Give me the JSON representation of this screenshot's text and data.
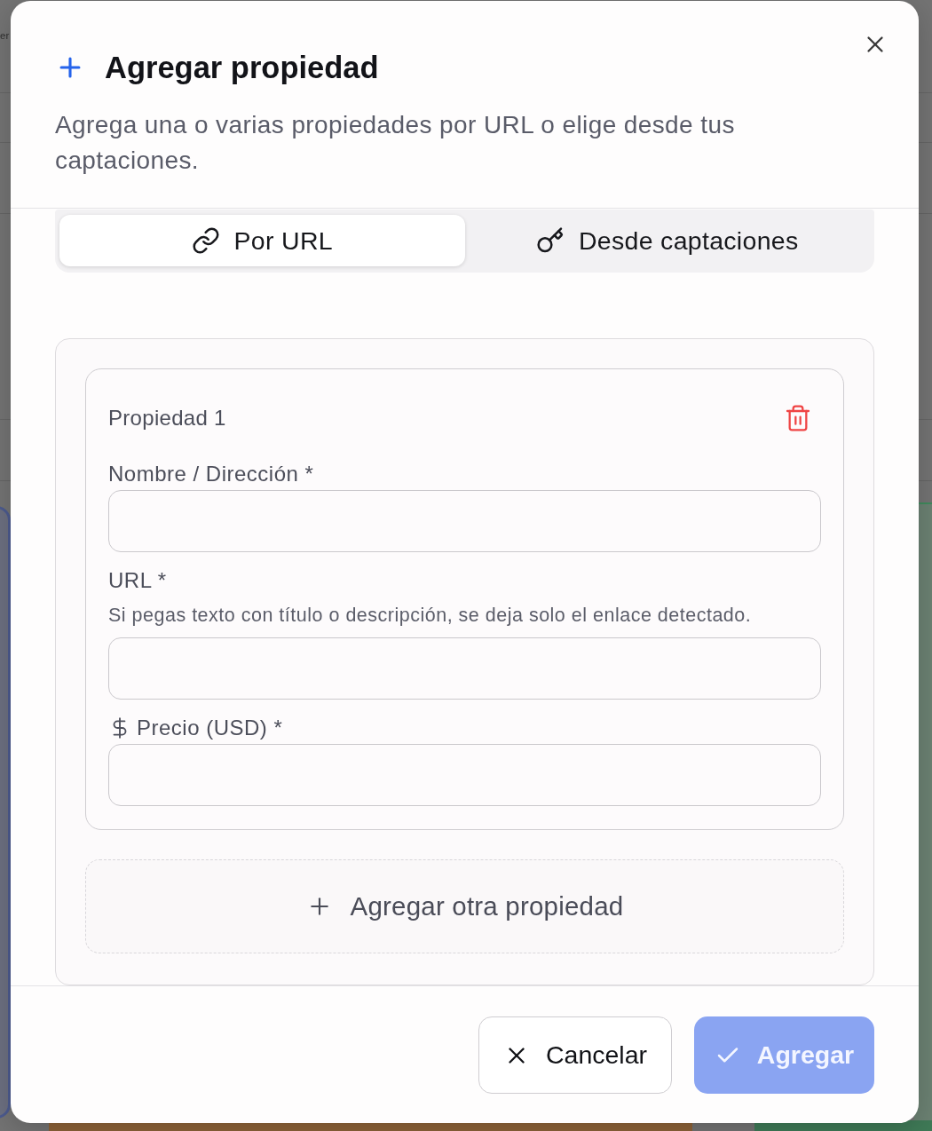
{
  "background": {
    "text": "er"
  },
  "dialog": {
    "title": "Agregar propiedad",
    "description": "Agrega una o varias propiedades por URL o elige desde tus captaciones."
  },
  "tabs": [
    {
      "label": "Por URL",
      "selected": true
    },
    {
      "label": "Desde captaciones",
      "selected": false
    }
  ],
  "properties": [
    {
      "title": "Propiedad 1",
      "fields": [
        {
          "kind": "text",
          "label": "Nombre / Dirección *"
        },
        {
          "kind": "text",
          "label": "URL *",
          "hint": "Si pegas texto con título o descripción, se deja solo el enlace detectado."
        },
        {
          "kind": "currency",
          "label": "Precio (USD) *"
        }
      ]
    }
  ],
  "add_property": {
    "label": "Agregar otra propiedad"
  },
  "footer": {
    "buttons": [
      {
        "kind": "secondary",
        "label": "Cancelar",
        "disabled": false
      },
      {
        "kind": "primary",
        "label": "Agregar",
        "disabled": true
      }
    ]
  }
}
